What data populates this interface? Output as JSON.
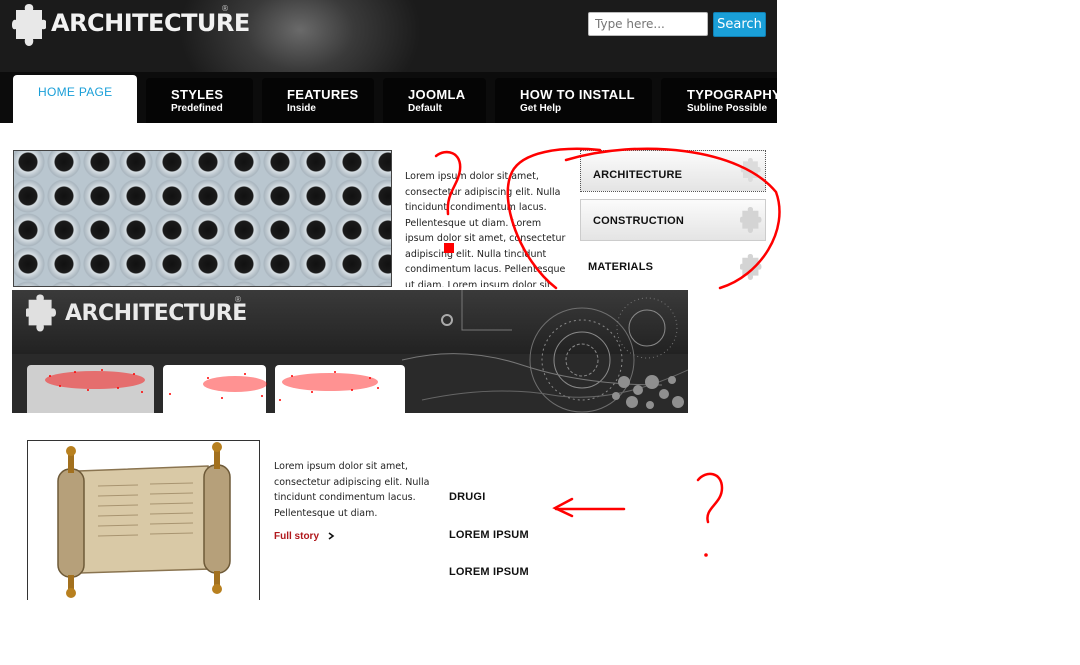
{
  "header": {
    "logo_text": "ARCHITECTURE",
    "logo_mark": "®",
    "search": {
      "placeholder": "Type here...",
      "button_label": "Search"
    },
    "nav": [
      {
        "title": "HOME PAGE",
        "subtitle": ""
      },
      {
        "title": "STYLES",
        "subtitle": "Predefined"
      },
      {
        "title": "FEATURES",
        "subtitle": "Inside"
      },
      {
        "title": "JOOMLA",
        "subtitle": "Default"
      },
      {
        "title": "HOW TO INSTALL",
        "subtitle": "Get Help"
      },
      {
        "title": "TYPOGRAPHY",
        "subtitle": "Subline Possible"
      }
    ]
  },
  "content_1": {
    "paragraph": "Lorem ipsum dolor sit amet, consectetur adipiscing elit. Nulla tincidunt condimentum lacus. Pellentesque ut diam. Lorem ipsum dolor sit amet, consectetur adipiscing elit. Nulla tincidunt condimentum lacus. Pellentesque ut diam. Lorem ipsum dolor sit amet,",
    "side_menu": [
      "ARCHITECTURE",
      "CONSTRUCTION",
      "MATERIALS"
    ]
  },
  "second_header": {
    "logo_text": "ARCHITECTURE",
    "logo_mark": "®"
  },
  "content_2": {
    "paragraph": "Lorem ipsum dolor sit amet, consectetur adipiscing elit. Nulla tincidunt condimentum lacus. Pellentesque ut diam.",
    "link_label": "Full story",
    "list": [
      "DRUGI",
      "LOREM IPSUM",
      "LOREM IPSUM"
    ]
  },
  "annotations": {
    "question_mark": "?"
  },
  "colors": {
    "accent_blue": "#1a9fd8",
    "link_red": "#b0171b",
    "markup_red": "#ff0000"
  },
  "icons": [
    "puzzle-logo-icon",
    "puzzle-watermark-icon",
    "chevron-right-icon",
    "scroll-image"
  ]
}
